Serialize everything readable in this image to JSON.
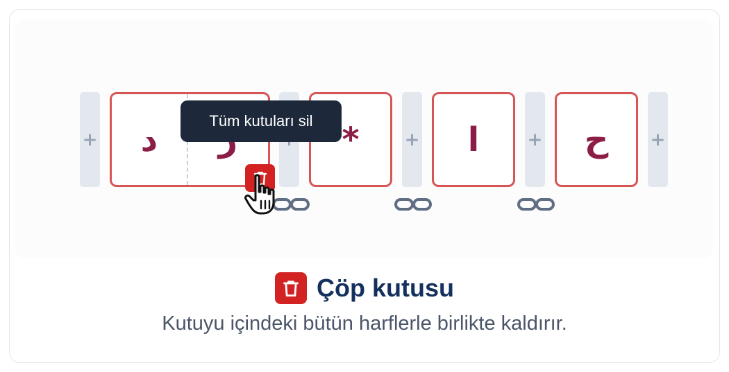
{
  "boxes": [
    {
      "letters": [
        "د",
        "ر"
      ]
    },
    {
      "letters": [
        "*"
      ]
    },
    {
      "letters": [
        "ا"
      ]
    },
    {
      "letters": [
        "ح"
      ]
    }
  ],
  "insert_symbol": "+",
  "tooltip": {
    "text": "Tüm kutuları sil"
  },
  "feature": {
    "title": "Çöp kutusu",
    "description": "Kutuyu içindeki bütün harflerle birlikte kaldırır."
  },
  "icons": {
    "trash": "trash-icon",
    "link": "link-icon",
    "cursor": "hand-pointer-icon"
  },
  "colors": {
    "box_border": "#d75555",
    "letter": "#8c1d46",
    "trash_bg": "#d22222",
    "tooltip_bg": "#1d293b",
    "title": "#14305c",
    "description": "#4a5568"
  }
}
